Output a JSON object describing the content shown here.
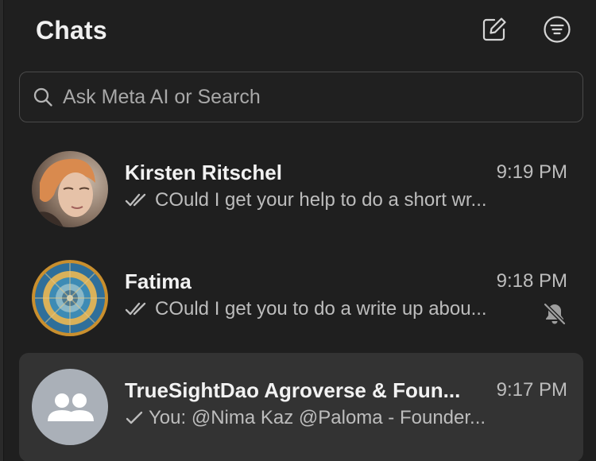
{
  "header": {
    "title": "Chats",
    "compose_icon": "compose-icon",
    "filter_icon": "filter-icon"
  },
  "search": {
    "placeholder": "Ask Meta AI or Search",
    "value": ""
  },
  "chats": [
    {
      "name": "Kirsten Ritschel",
      "time": "9:19 PM",
      "status": "double-check",
      "preview": "COuld I get your help to do a short wr...",
      "muted": false,
      "avatar": "photo"
    },
    {
      "name": "Fatima",
      "time": "9:18 PM",
      "status": "double-check",
      "preview": "COuld I get you to do a write up abou...",
      "muted": true,
      "avatar": "mosaic"
    },
    {
      "name": "TrueSightDao Agroverse & Foun...",
      "time": "9:17 PM",
      "status": "single-check",
      "preview": "You: @Nima Kaz @Paloma - Founder...",
      "muted": false,
      "avatar": "group-default"
    }
  ],
  "colors": {
    "background": "#1f1f1f",
    "selected_row": "#333333",
    "text_primary": "#f2f2f2",
    "text_secondary": "#bdbdbd"
  }
}
